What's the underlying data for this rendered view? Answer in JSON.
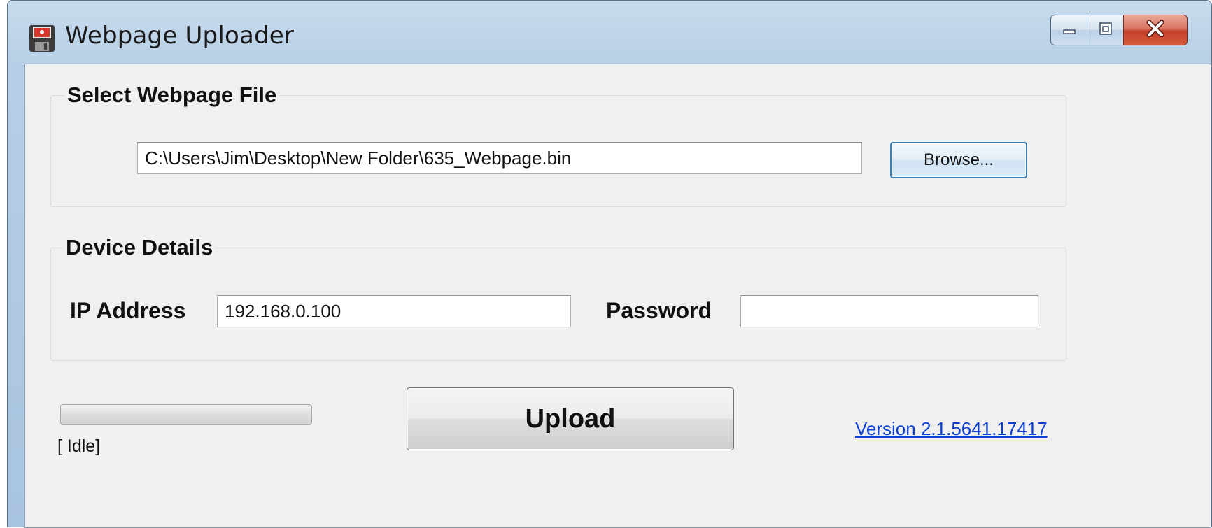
{
  "window": {
    "title": "Webpage Uploader",
    "icon": "floppy-disk-icon",
    "controls": {
      "minimize": "minimize-icon",
      "maximize": "maximize-icon",
      "close": "close-icon"
    }
  },
  "file_group": {
    "title": "Select Webpage File",
    "file_path": "C:\\Users\\Jim\\Desktop\\New Folder\\635_Webpage.bin",
    "browse_label": "Browse..."
  },
  "device_group": {
    "title": "Device Details",
    "ip_label": "IP Address",
    "ip_value": "192.168.0.100",
    "password_label": "Password",
    "password_value": ""
  },
  "footer": {
    "progress": 0,
    "status": "[ Idle]",
    "upload_label": "Upload",
    "version": "Version 2.1.5641.17417"
  },
  "colors": {
    "link": "#0b3fd1",
    "close_button": "#c4412a",
    "client_background": "#f0f0f0"
  }
}
